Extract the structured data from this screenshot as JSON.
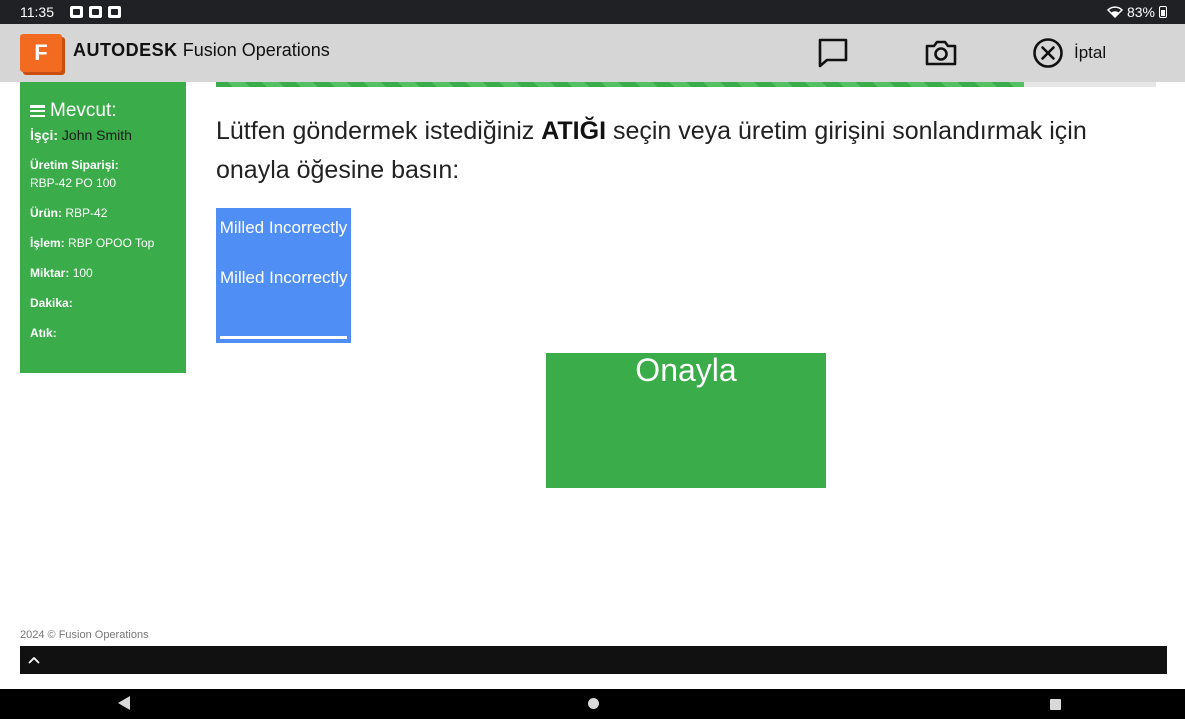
{
  "status_bar": {
    "time": "11:35",
    "battery": "83%",
    "notification_icons": [
      "gallery-icon",
      "screen-cast-icon",
      "record-icon"
    ]
  },
  "header": {
    "logo_letter": "F",
    "brand_bold": "AUTODESK",
    "brand_rest": "Fusion Operations",
    "cancel_label": "İptal",
    "accent_color": "#f36b21"
  },
  "progress": {
    "fraction": 0.86,
    "color": "#3aac4a"
  },
  "sidebar": {
    "title": "Mevcut:",
    "worker_label": "İşçi:",
    "worker_value": "John Smith",
    "order_label": "Üretim Siparişi:",
    "order_value": "RBP-42 PO 100",
    "product_label": "Ürün:",
    "product_value": "RBP-42",
    "operation_label": "İşlem:",
    "operation_value": "RBP OPOO Top",
    "quantity_label": "Miktar:",
    "quantity_value": "100",
    "minutes_label": "Dakika:",
    "scrap_label": "Atık:"
  },
  "main": {
    "instruction_before": "Lütfen göndermek istediğiniz ",
    "instruction_bold": "ATIĞI",
    "instruction_after": " seçin veya üretim girişini sonlandırmak için onayla öğesine basın:",
    "scrap_option": {
      "title": "Milled Incorrectly",
      "subtitle": "Milled Incorrectly"
    },
    "confirm_label": "Onayla"
  },
  "footer": {
    "copyright": "2024 © Fusion Operations"
  }
}
